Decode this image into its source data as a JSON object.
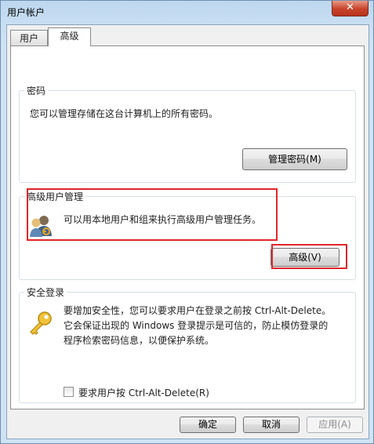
{
  "window": {
    "title": "用户帐户",
    "close_glyph": "✕"
  },
  "tabs": [
    "用户",
    "高级"
  ],
  "passwords": {
    "legend": "密码",
    "description": "您可以管理存储在这台计算机上的所有密码。",
    "manage_button": "管理密码(M)"
  },
  "advanced_user_mgmt": {
    "legend": "高级用户管理",
    "description": "可以用本地用户和组来执行高级用户管理任务。",
    "advanced_button": "高级(V)"
  },
  "secure_logon": {
    "legend": "安全登录",
    "description_lines": [
      "要增加安全性，您可以要求用户在登录之前按 Ctrl-Alt-Delete。",
      "它会保证出现的 Windows 登录提示是可信的，防止模仿登录的",
      "程序检索密码信息，以便保护系统。"
    ],
    "checkbox_label": "要求用户按 Ctrl-Alt-Delete(R)",
    "checkbox_checked": false
  },
  "footer": {
    "ok": "确定",
    "cancel": "取消",
    "apply": "应用(A)"
  }
}
